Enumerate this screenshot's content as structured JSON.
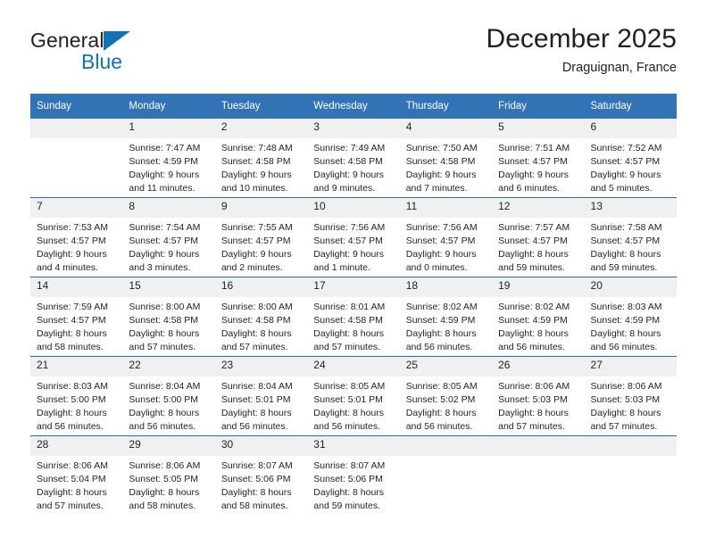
{
  "brand": {
    "name_primary": "General",
    "name_secondary": "Blue",
    "triangle_color": "#1272b6"
  },
  "header": {
    "title": "December 2025",
    "subtitle": "Draguignan, France"
  },
  "theme": {
    "header_blue": "#3273b5",
    "row_divider_blue": "#2a6cb0",
    "daynum_band": "#f0f0f0",
    "text": "#231f20"
  },
  "weekday_headers": [
    "Sunday",
    "Monday",
    "Tuesday",
    "Wednesday",
    "Thursday",
    "Friday",
    "Saturday"
  ],
  "weeks": [
    [
      {
        "day": "",
        "empty": true
      },
      {
        "day": "1",
        "sunrise": "Sunrise: 7:47 AM",
        "sunset": "Sunset: 4:59 PM",
        "daylight_line1": "Daylight: 9 hours",
        "daylight_line2": "and 11 minutes."
      },
      {
        "day": "2",
        "sunrise": "Sunrise: 7:48 AM",
        "sunset": "Sunset: 4:58 PM",
        "daylight_line1": "Daylight: 9 hours",
        "daylight_line2": "and 10 minutes."
      },
      {
        "day": "3",
        "sunrise": "Sunrise: 7:49 AM",
        "sunset": "Sunset: 4:58 PM",
        "daylight_line1": "Daylight: 9 hours",
        "daylight_line2": "and 9 minutes."
      },
      {
        "day": "4",
        "sunrise": "Sunrise: 7:50 AM",
        "sunset": "Sunset: 4:58 PM",
        "daylight_line1": "Daylight: 9 hours",
        "daylight_line2": "and 7 minutes."
      },
      {
        "day": "5",
        "sunrise": "Sunrise: 7:51 AM",
        "sunset": "Sunset: 4:57 PM",
        "daylight_line1": "Daylight: 9 hours",
        "daylight_line2": "and 6 minutes."
      },
      {
        "day": "6",
        "sunrise": "Sunrise: 7:52 AM",
        "sunset": "Sunset: 4:57 PM",
        "daylight_line1": "Daylight: 9 hours",
        "daylight_line2": "and 5 minutes."
      }
    ],
    [
      {
        "day": "7",
        "sunrise": "Sunrise: 7:53 AM",
        "sunset": "Sunset: 4:57 PM",
        "daylight_line1": "Daylight: 9 hours",
        "daylight_line2": "and 4 minutes."
      },
      {
        "day": "8",
        "sunrise": "Sunrise: 7:54 AM",
        "sunset": "Sunset: 4:57 PM",
        "daylight_line1": "Daylight: 9 hours",
        "daylight_line2": "and 3 minutes."
      },
      {
        "day": "9",
        "sunrise": "Sunrise: 7:55 AM",
        "sunset": "Sunset: 4:57 PM",
        "daylight_line1": "Daylight: 9 hours",
        "daylight_line2": "and 2 minutes."
      },
      {
        "day": "10",
        "sunrise": "Sunrise: 7:56 AM",
        "sunset": "Sunset: 4:57 PM",
        "daylight_line1": "Daylight: 9 hours",
        "daylight_line2": "and 1 minute."
      },
      {
        "day": "11",
        "sunrise": "Sunrise: 7:56 AM",
        "sunset": "Sunset: 4:57 PM",
        "daylight_line1": "Daylight: 9 hours",
        "daylight_line2": "and 0 minutes."
      },
      {
        "day": "12",
        "sunrise": "Sunrise: 7:57 AM",
        "sunset": "Sunset: 4:57 PM",
        "daylight_line1": "Daylight: 8 hours",
        "daylight_line2": "and 59 minutes."
      },
      {
        "day": "13",
        "sunrise": "Sunrise: 7:58 AM",
        "sunset": "Sunset: 4:57 PM",
        "daylight_line1": "Daylight: 8 hours",
        "daylight_line2": "and 59 minutes."
      }
    ],
    [
      {
        "day": "14",
        "sunrise": "Sunrise: 7:59 AM",
        "sunset": "Sunset: 4:57 PM",
        "daylight_line1": "Daylight: 8 hours",
        "daylight_line2": "and 58 minutes."
      },
      {
        "day": "15",
        "sunrise": "Sunrise: 8:00 AM",
        "sunset": "Sunset: 4:58 PM",
        "daylight_line1": "Daylight: 8 hours",
        "daylight_line2": "and 57 minutes."
      },
      {
        "day": "16",
        "sunrise": "Sunrise: 8:00 AM",
        "sunset": "Sunset: 4:58 PM",
        "daylight_line1": "Daylight: 8 hours",
        "daylight_line2": "and 57 minutes."
      },
      {
        "day": "17",
        "sunrise": "Sunrise: 8:01 AM",
        "sunset": "Sunset: 4:58 PM",
        "daylight_line1": "Daylight: 8 hours",
        "daylight_line2": "and 57 minutes."
      },
      {
        "day": "18",
        "sunrise": "Sunrise: 8:02 AM",
        "sunset": "Sunset: 4:59 PM",
        "daylight_line1": "Daylight: 8 hours",
        "daylight_line2": "and 56 minutes."
      },
      {
        "day": "19",
        "sunrise": "Sunrise: 8:02 AM",
        "sunset": "Sunset: 4:59 PM",
        "daylight_line1": "Daylight: 8 hours",
        "daylight_line2": "and 56 minutes."
      },
      {
        "day": "20",
        "sunrise": "Sunrise: 8:03 AM",
        "sunset": "Sunset: 4:59 PM",
        "daylight_line1": "Daylight: 8 hours",
        "daylight_line2": "and 56 minutes."
      }
    ],
    [
      {
        "day": "21",
        "sunrise": "Sunrise: 8:03 AM",
        "sunset": "Sunset: 5:00 PM",
        "daylight_line1": "Daylight: 8 hours",
        "daylight_line2": "and 56 minutes."
      },
      {
        "day": "22",
        "sunrise": "Sunrise: 8:04 AM",
        "sunset": "Sunset: 5:00 PM",
        "daylight_line1": "Daylight: 8 hours",
        "daylight_line2": "and 56 minutes."
      },
      {
        "day": "23",
        "sunrise": "Sunrise: 8:04 AM",
        "sunset": "Sunset: 5:01 PM",
        "daylight_line1": "Daylight: 8 hours",
        "daylight_line2": "and 56 minutes."
      },
      {
        "day": "24",
        "sunrise": "Sunrise: 8:05 AM",
        "sunset": "Sunset: 5:01 PM",
        "daylight_line1": "Daylight: 8 hours",
        "daylight_line2": "and 56 minutes."
      },
      {
        "day": "25",
        "sunrise": "Sunrise: 8:05 AM",
        "sunset": "Sunset: 5:02 PM",
        "daylight_line1": "Daylight: 8 hours",
        "daylight_line2": "and 56 minutes."
      },
      {
        "day": "26",
        "sunrise": "Sunrise: 8:06 AM",
        "sunset": "Sunset: 5:03 PM",
        "daylight_line1": "Daylight: 8 hours",
        "daylight_line2": "and 57 minutes."
      },
      {
        "day": "27",
        "sunrise": "Sunrise: 8:06 AM",
        "sunset": "Sunset: 5:03 PM",
        "daylight_line1": "Daylight: 8 hours",
        "daylight_line2": "and 57 minutes."
      }
    ],
    [
      {
        "day": "28",
        "sunrise": "Sunrise: 8:06 AM",
        "sunset": "Sunset: 5:04 PM",
        "daylight_line1": "Daylight: 8 hours",
        "daylight_line2": "and 57 minutes."
      },
      {
        "day": "29",
        "sunrise": "Sunrise: 8:06 AM",
        "sunset": "Sunset: 5:05 PM",
        "daylight_line1": "Daylight: 8 hours",
        "daylight_line2": "and 58 minutes."
      },
      {
        "day": "30",
        "sunrise": "Sunrise: 8:07 AM",
        "sunset": "Sunset: 5:06 PM",
        "daylight_line1": "Daylight: 8 hours",
        "daylight_line2": "and 58 minutes."
      },
      {
        "day": "31",
        "sunrise": "Sunrise: 8:07 AM",
        "sunset": "Sunset: 5:06 PM",
        "daylight_line1": "Daylight: 8 hours",
        "daylight_line2": "and 59 minutes."
      },
      {
        "day": "",
        "empty": true
      },
      {
        "day": "",
        "empty": true
      },
      {
        "day": "",
        "empty": true
      }
    ]
  ]
}
